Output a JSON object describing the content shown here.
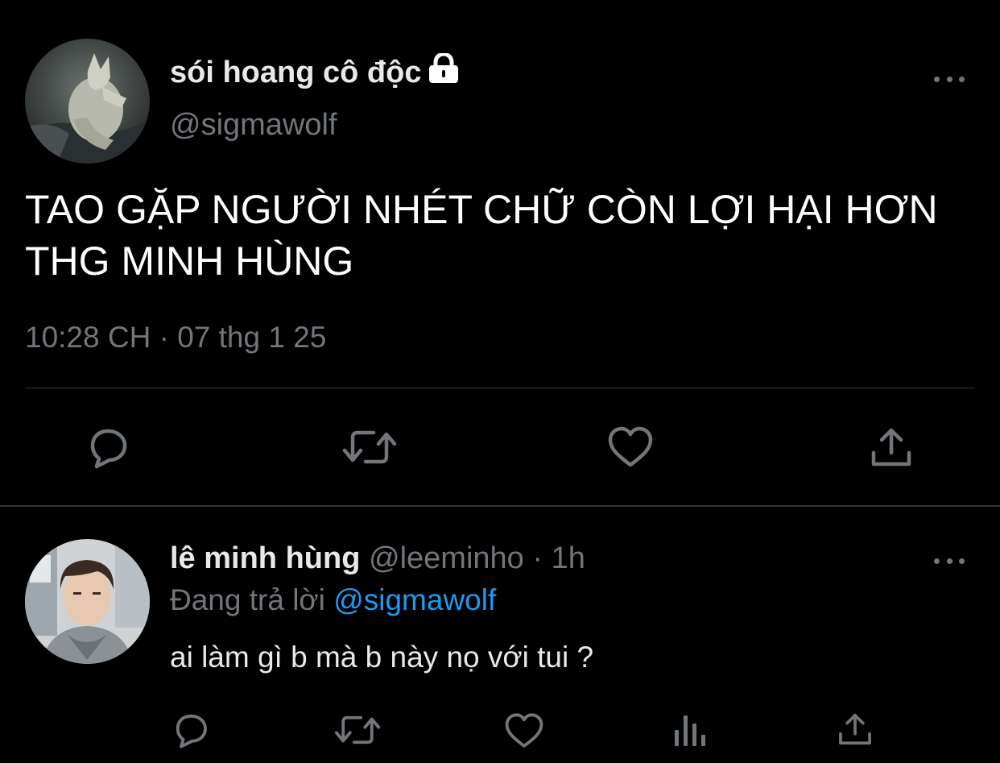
{
  "colors": {
    "background": "#000000",
    "primary_text": "#E7E9EA",
    "secondary_text": "#71767B",
    "link": "#1D9BF0",
    "divider": "#2F3336"
  },
  "main_tweet": {
    "avatar_icon": "werewolf-avatar",
    "display_name": "sói hoang cô độc",
    "protected_icon": "lock-icon",
    "handle": "@sigmawolf",
    "more_icon": "more-horizontal-icon",
    "text": "TAO GẶP NGƯỜI NHÉT CHỮ CÒN LỢI HẠI HƠN\nTHG MINH HÙNG",
    "timestamp": "10:28 CH · 07 thg 1 25",
    "actions": [
      "reply-icon",
      "retweet-icon",
      "like-icon",
      "share-icon"
    ]
  },
  "reply_tweet": {
    "avatar_icon": "user-photo-avatar",
    "display_name": "lê minh hùng",
    "handle": "@leeminho",
    "separator": "·",
    "time": "1h",
    "more_icon": "more-horizontal-icon",
    "replying_to_label": "Đang trả lời",
    "replying_to_handle": "@sigmawolf",
    "text": "ai làm gì b mà b này nọ với tui ?",
    "actions": [
      "reply-icon",
      "retweet-icon",
      "like-icon",
      "analytics-icon",
      "share-icon"
    ]
  }
}
